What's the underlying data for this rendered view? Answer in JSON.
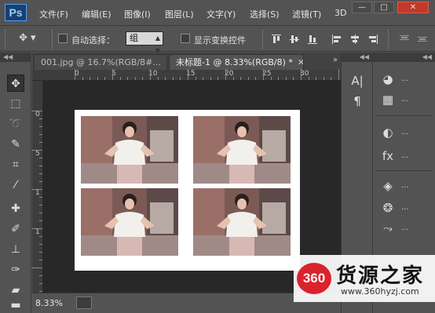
{
  "app": {
    "logo": "Ps"
  },
  "menu": [
    "文件(F)",
    "编辑(E)",
    "图像(I)",
    "图层(L)",
    "文字(Y)",
    "选择(S)",
    "滤镜(T)",
    "3D"
  ],
  "window_controls": {
    "minimize": "—",
    "maximize": "□",
    "close": "✕"
  },
  "options": {
    "auto_select_label": "自动选择：",
    "auto_select_value": "组",
    "show_transform_label": "显示变换控件"
  },
  "tabs": [
    {
      "label": "001.jpg @ 16.7%(RGB/8#...",
      "close": "✕"
    },
    {
      "label": "未标题-1 @ 8.33%(RGB/8) *",
      "close": "✕"
    }
  ],
  "ruler": {
    "h_labels": [
      "0",
      "5",
      "10",
      "15",
      "20",
      "25",
      "30"
    ],
    "v_labels": [
      "0",
      "5",
      "1",
      "1"
    ]
  },
  "status": {
    "zoom": "8.33%"
  },
  "panels": {
    "dots": "..."
  },
  "watermark": {
    "logo": "360",
    "name": "货源之家",
    "url": "www.360hyzj.com"
  },
  "colors": {
    "ui_bg": "#535353",
    "canvas_bg": "#282828",
    "document": "#ffffff",
    "watermark_red": "#d9232d"
  },
  "icons": [
    "move-icon",
    "marquee-icon",
    "lasso-icon",
    "quick-select-icon",
    "crop-icon",
    "eyedropper-icon",
    "healing-icon",
    "brush-icon",
    "stamp-icon",
    "history-brush-icon",
    "eraser-icon",
    "gradient-icon",
    "character-icon",
    "paragraph-icon",
    "color-icon",
    "swatches-icon",
    "adjustments-icon",
    "styles-icon",
    "layers-icon",
    "channels-icon",
    "paths-icon"
  ]
}
